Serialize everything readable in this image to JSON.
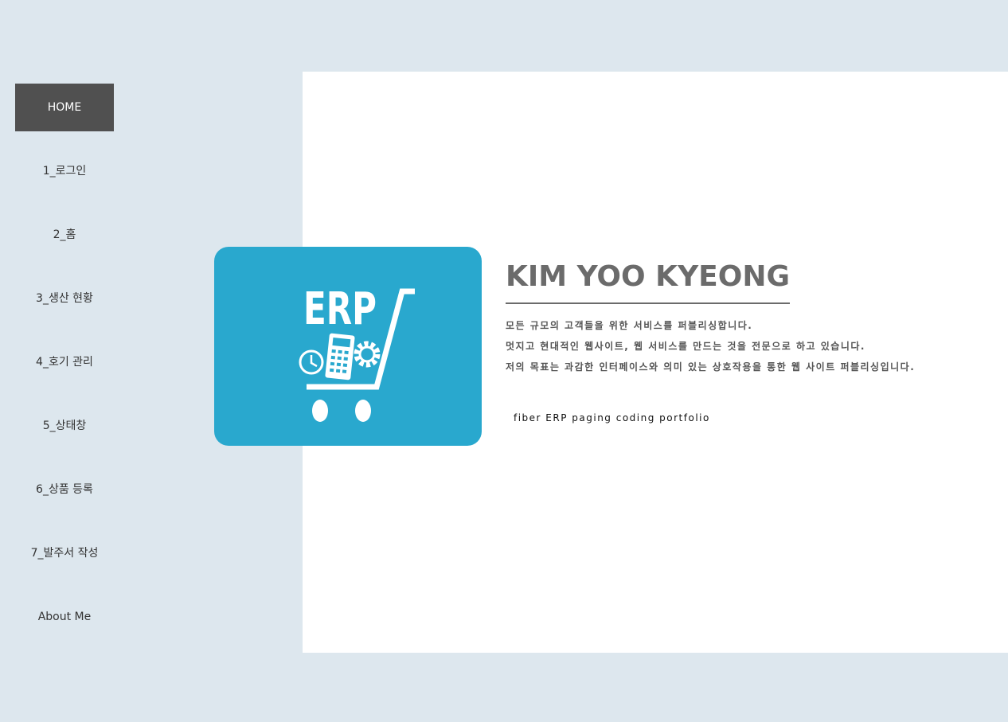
{
  "nav": {
    "items": [
      {
        "label": "HOME",
        "active": true
      },
      {
        "label": "1_로그인"
      },
      {
        "label": "2_홈"
      },
      {
        "label": "3_생산 현황"
      },
      {
        "label": "4_호기 관리"
      },
      {
        "label": "5_상태창"
      },
      {
        "label": "6_상품 등록"
      },
      {
        "label": "7_발주서 작성"
      },
      {
        "label": "About Me"
      }
    ]
  },
  "hero": {
    "logo_text": "ERP",
    "logo_icon": "shopping-cart-calculator-gear-clock",
    "name": "KIM YOO KYEONG",
    "lines": [
      "모든 규모의 고객들을 위한 서비스를 퍼블리싱합니다.",
      "멋지고 현대적인 웹사이트, 웹 서비스를 만드는 것을 전문으로 하고 있습니다.",
      "저의 목표는 과감한 인터페이스와 의미 있는 상호작용을 통한 웹 사이트 퍼블리싱입니다."
    ],
    "tagline": "fiber ERP paging coding portfolio"
  },
  "colors": {
    "page_background": "#dde7ee",
    "panel_background": "#ffffff",
    "nav_active_background": "#505050",
    "nav_active_text": "#ffffff",
    "logo_card": "#29a8ce",
    "name_text": "#6b6b6b"
  }
}
